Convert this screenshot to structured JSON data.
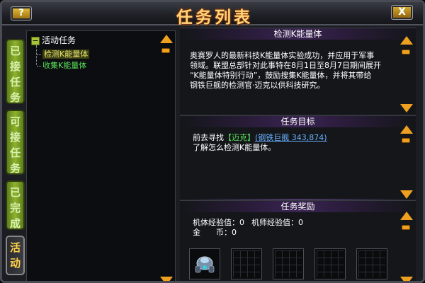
{
  "window": {
    "title": "任务列表",
    "help_label": "?",
    "close_label": "X"
  },
  "side_tabs": [
    {
      "label_chars": [
        "已",
        "接",
        "任",
        "务"
      ],
      "active": false
    },
    {
      "label_chars": [
        "可",
        "接",
        "任",
        "务"
      ],
      "active": false
    },
    {
      "label_chars": [
        "已",
        "完",
        "成"
      ],
      "active": false
    },
    {
      "label_chars": [
        "活",
        "动"
      ],
      "active": true
    }
  ],
  "tree": {
    "root_label": "活动任务",
    "items": [
      {
        "label": "检测K能量体",
        "selected": true
      },
      {
        "label": "收集K能量体",
        "selected": false
      }
    ]
  },
  "description": {
    "header": "检测K能量体",
    "lines": [
      "奥赛罗人的最新科技K能量体实验成功，并应用于军事",
      "领域。联盟总部针对此事特在8月1日至8月7日期间展开",
      "“K能量体特别行动”，鼓励搜集K能量体，并将其带给",
      "钢铁巨舰的检测官·迈克以供科技研究。"
    ]
  },
  "objective": {
    "header": "任务目标",
    "line1_prefix": "前去寻找",
    "npc_name": "【迈克】",
    "npc_location": "(钢铁巨舰 343,874)",
    "line2": "了解怎么检测K能量体。"
  },
  "reward": {
    "header": "任务奖励",
    "mech_exp_label": "机体经验值：0",
    "pilot_exp_label": "机师经验值：0",
    "gold_label": "金　　币：0",
    "slot_icons": [
      "robot-reward-icon",
      "empty",
      "empty",
      "empty",
      "empty"
    ]
  },
  "colors": {
    "accent_orange": "#f0a020",
    "tab_green": "#8fb32c",
    "title_gold": "#ffd57a",
    "npc_green": "#58e058",
    "link_blue": "#6ab2ff"
  }
}
